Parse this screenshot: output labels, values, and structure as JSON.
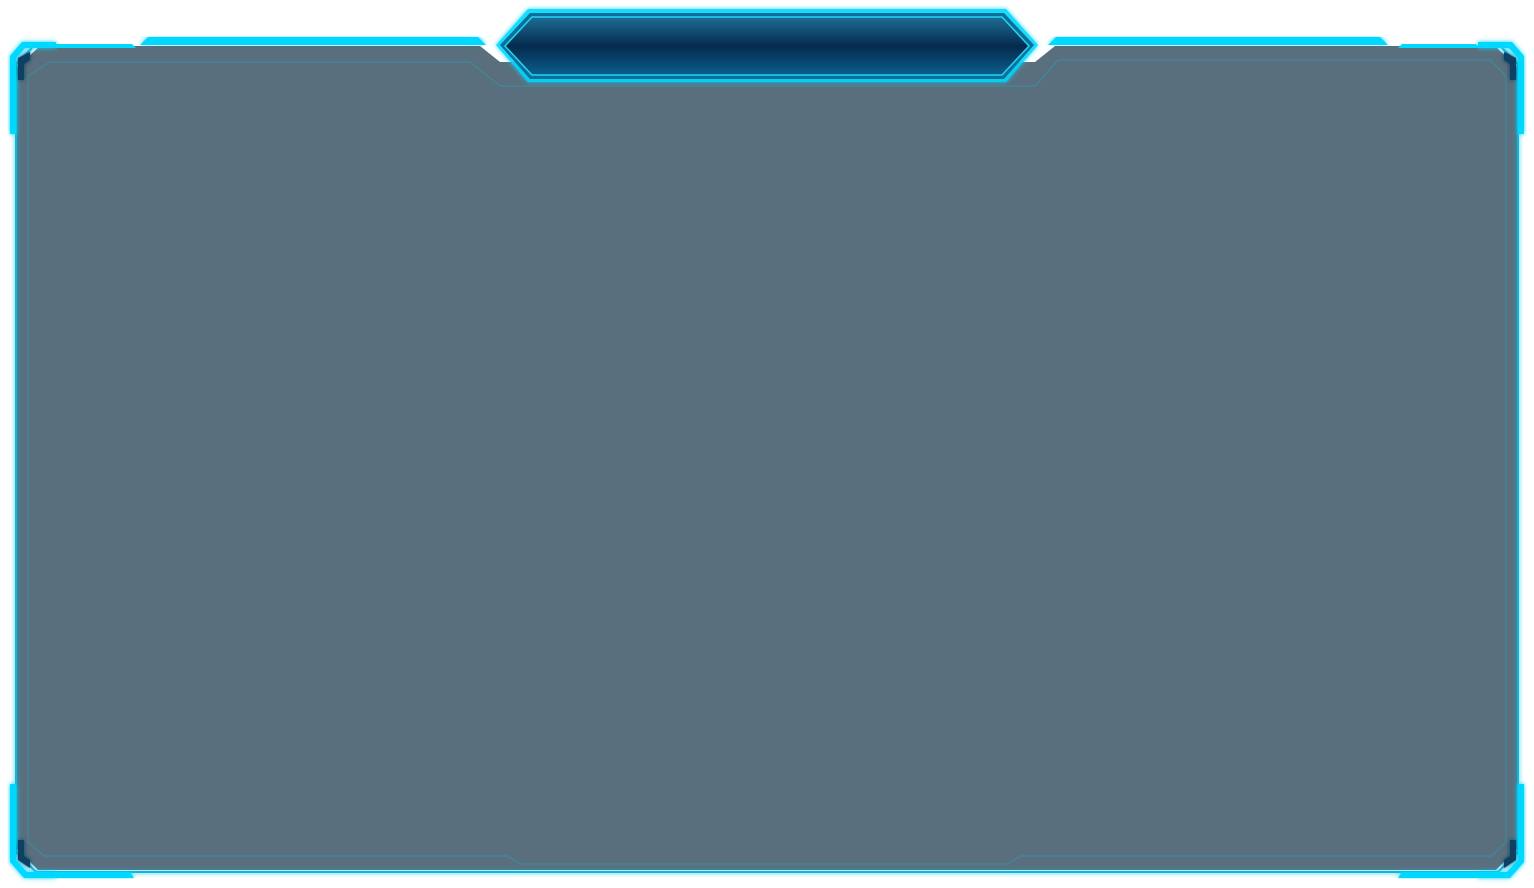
{
  "panel": {
    "title": ""
  },
  "colors": {
    "accent": "#00d8ff",
    "accent_dim": "#1aa7c4",
    "panel_fill": "#5a6f7d",
    "header_dark": "#062b4f",
    "header_mid": "#0b4f78"
  }
}
